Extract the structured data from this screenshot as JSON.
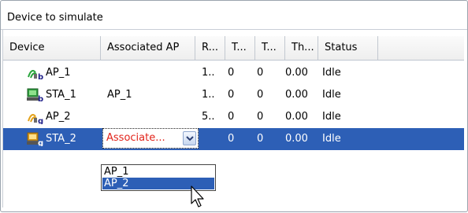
{
  "panel": {
    "title": "Device to simulate"
  },
  "columns": [
    "Device",
    "Associated AP",
    "R...",
    "T...",
    "T...",
    "Th...",
    "Status"
  ],
  "rows": [
    {
      "icon": "ap-b-icon",
      "device": "AP_1",
      "associated_ap": "",
      "r": "1..",
      "t1": "0",
      "t2": "0",
      "th": "0.00",
      "status": "Idle",
      "selected": false
    },
    {
      "icon": "sta-b-icon",
      "device": "STA_1",
      "associated_ap": "AP_1",
      "r": "1..",
      "t1": "0",
      "t2": "0",
      "th": "0.00",
      "status": "Idle",
      "selected": false
    },
    {
      "icon": "ap-g-icon",
      "device": "AP_2",
      "associated_ap": "",
      "r": "5..",
      "t1": "0",
      "t2": "0",
      "th": "0.00",
      "status": "Idle",
      "selected": false
    },
    {
      "icon": "sta-g-icon",
      "device": "STA_2",
      "associated_ap": "Associate...",
      "r": "",
      "t1": "0",
      "t2": "0",
      "th": "0.00",
      "status": "Idle",
      "selected": true
    }
  ],
  "dropdown": {
    "options": [
      "AP_1",
      "AP_2"
    ],
    "highlighted": "AP_2"
  },
  "colors": {
    "selection": "#2d5fb6",
    "combo_text": "#e2231a",
    "border": "#9aa3ad"
  }
}
